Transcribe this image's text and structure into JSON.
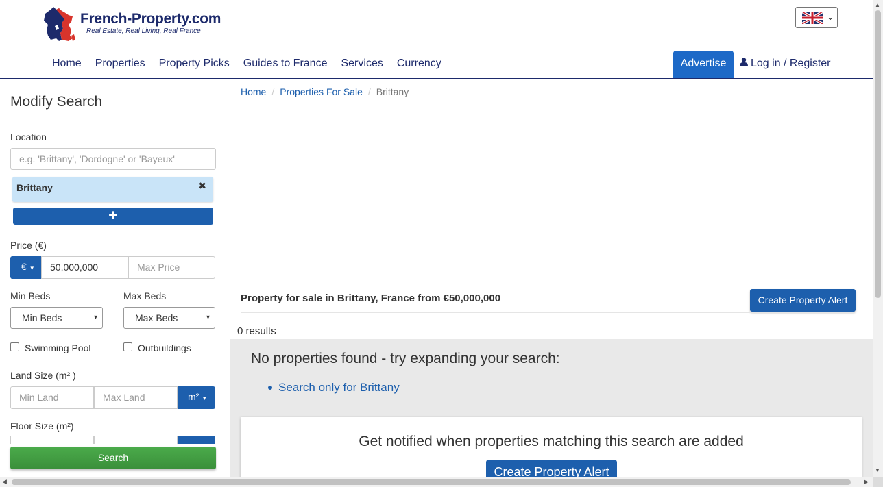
{
  "header": {
    "logo_name": "French-Property.com",
    "logo_tagline": "Real Estate, Real Living, Real France",
    "language_flag": "uk-flag-icon",
    "nav": [
      {
        "label": "Home"
      },
      {
        "label": "Properties"
      },
      {
        "label": "Property Picks"
      },
      {
        "label": "Guides to France"
      },
      {
        "label": "Services"
      },
      {
        "label": "Currency"
      }
    ],
    "advertise_label": "Advertise",
    "login_label": "Log in / Register"
  },
  "sidebar": {
    "title": "Modify Search",
    "location_label": "Location",
    "location_placeholder": "e.g. 'Brittany', 'Dordogne' or 'Bayeux'",
    "location_chip": "Brittany",
    "price_label": "Price (€)",
    "currency_symbol": "€",
    "min_price_value": "50,000,000",
    "max_price_placeholder": "Max Price",
    "min_beds_label": "Min Beds",
    "min_beds_value": "Min Beds",
    "max_beds_label": "Max Beds",
    "max_beds_value": "Max Beds",
    "pool_label": "Swimming Pool",
    "outbuildings_label": "Outbuildings",
    "land_label": "Land Size (m² )",
    "min_land_placeholder": "Min Land",
    "max_land_placeholder": "Max Land",
    "land_unit": "m²",
    "floor_label": "Floor Size (m²)",
    "search_label": "Search"
  },
  "main": {
    "breadcrumb": [
      "Home",
      "Properties For Sale",
      "Brittany"
    ],
    "heading": "Property for sale in Brittany, France from €50,000,000",
    "alert_button": "Create Property Alert",
    "results": "0 results",
    "no_found": "No properties found - try expanding your search:",
    "suggestion_link": "Search only for Brittany",
    "notify_text": "Get notified when properties matching this search are added",
    "notify_button": "Create Property Alert"
  },
  "colors": {
    "brand_navy": "#1d2a6b",
    "button_blue": "#1d5fad",
    "search_green": "#3a9a3a",
    "chip_bg": "#c9e4f8"
  }
}
